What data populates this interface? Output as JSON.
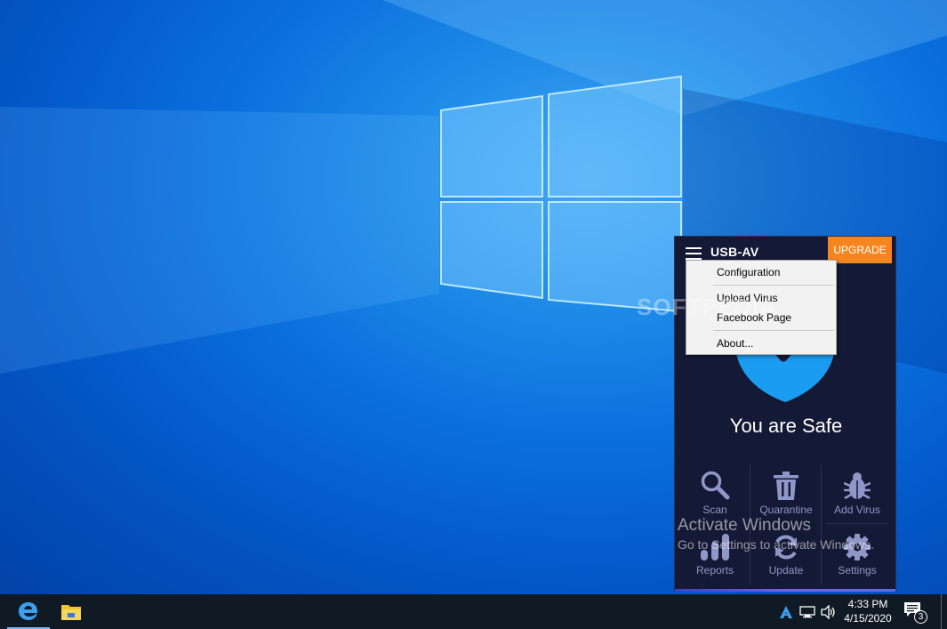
{
  "desktop": {
    "watermark": "SOFTPEDIA",
    "activation": {
      "title": "Activate Windows",
      "subtitle": "Go to Settings to activate Windows."
    }
  },
  "app": {
    "title": "USB-AV",
    "upgrade_label": "UPGRADE",
    "status": "You are Safe",
    "tiles": [
      {
        "label": "Scan",
        "icon": "search-icon"
      },
      {
        "label": "Quarantine",
        "icon": "trash-icon"
      },
      {
        "label": "Add Virus",
        "icon": "bug-icon"
      },
      {
        "label": "Reports",
        "icon": "bar-chart-icon"
      },
      {
        "label": "Update",
        "icon": "refresh-icon"
      },
      {
        "label": "Settings",
        "icon": "gear-icon"
      }
    ],
    "colors": {
      "background": "#141935",
      "accent": "#f5851f",
      "shield": "#1a9cf0",
      "tile_text": "#8f97c8"
    }
  },
  "menu": {
    "items": [
      {
        "label": "Configuration"
      },
      {
        "label": "Upload Virus"
      },
      {
        "label": "Facebook Page"
      },
      {
        "label": "About..."
      }
    ]
  },
  "taskbar": {
    "pinned": [
      {
        "name": "Microsoft Edge",
        "icon": "edge-icon"
      },
      {
        "name": "File Explorer",
        "icon": "folder-icon"
      }
    ],
    "tray_icons": [
      "usb-av-tray-icon",
      "network-icon",
      "volume-icon"
    ],
    "time": "4:33 PM",
    "date": "4/15/2020",
    "notification_count": "3"
  }
}
